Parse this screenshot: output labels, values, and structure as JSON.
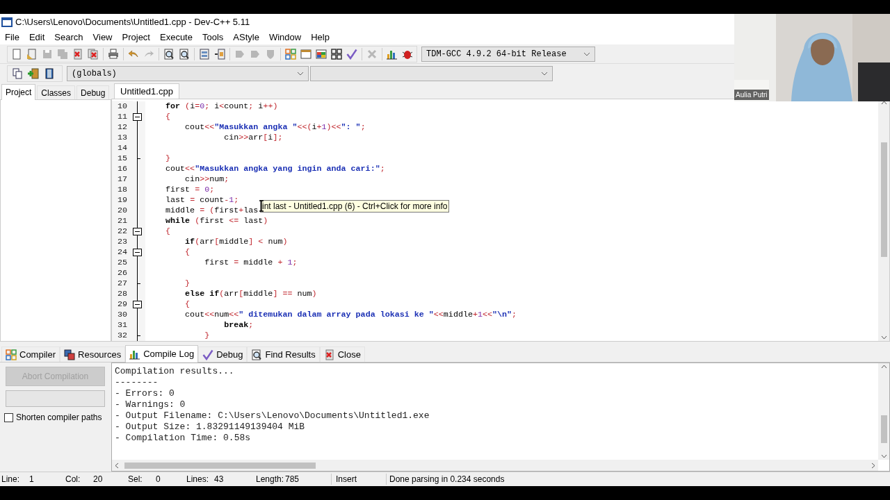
{
  "window": {
    "title": "C:\\Users\\Lenovo\\Documents\\Untitled1.cpp - Dev-C++ 5.11"
  },
  "menu": [
    "File",
    "Edit",
    "Search",
    "View",
    "Project",
    "Execute",
    "Tools",
    "AStyle",
    "Window",
    "Help"
  ],
  "toolbar": [
    {
      "disabled": false
    },
    {
      "disabled": false
    },
    {
      "disabled": true
    },
    {
      "disabled": true
    },
    {
      "disabled": false
    },
    {
      "disabled": false
    },
    {
      "disabled": false
    },
    {
      "disabled": false
    },
    {
      "disabled": true
    },
    {
      "disabled": false
    },
    {
      "disabled": false
    },
    {
      "disabled": false
    },
    {
      "disabled": false
    },
    {
      "disabled": true
    },
    {
      "disabled": true
    },
    {
      "disabled": true
    },
    {
      "disabled": false
    },
    {
      "disabled": false
    },
    {
      "disabled": false
    },
    {
      "disabled": false
    },
    {
      "disabled": false
    },
    {
      "disabled": true
    },
    {
      "disabled": false
    },
    {
      "disabled": false
    }
  ],
  "compiler_select": {
    "value": "TDM-GCC 4.9.2 64-bit Release"
  },
  "toolbar2": [
    {
      "disabled": false
    },
    {
      "disabled": false
    },
    {
      "disabled": false
    }
  ],
  "scope_select": {
    "value": "(globals)"
  },
  "left_tabs": [
    {
      "label": "Project",
      "selected": true
    },
    {
      "label": "Classes",
      "selected": false
    },
    {
      "label": "Debug",
      "selected": false
    }
  ],
  "editor_tabs": [
    {
      "label": "Untitled1.cpp",
      "selected": true
    }
  ],
  "code": [
    {
      "number": "10",
      "kind": "plain",
      "tokens": [
        {
          "kind": "kw",
          "t": "    for"
        },
        {
          "kind": "op",
          "t": " ("
        },
        {
          "kind": "id",
          "t": "i"
        },
        {
          "kind": "op",
          "t": "="
        },
        {
          "kind": "num",
          "t": "0"
        },
        {
          "kind": "op",
          "t": "; "
        },
        {
          "kind": "id",
          "t": "i"
        },
        {
          "kind": "op",
          "t": "<"
        },
        {
          "kind": "id",
          "t": "count"
        },
        {
          "kind": "op",
          "t": "; "
        },
        {
          "kind": "id",
          "t": "i"
        },
        {
          "kind": "op",
          "t": "++)"
        }
      ]
    },
    {
      "number": "11",
      "kind": "fold_start",
      "tokens": [
        {
          "kind": "op",
          "t": "    {"
        }
      ]
    },
    {
      "number": "12",
      "kind": "plain",
      "tokens": [
        {
          "kind": "id",
          "t": "        cout"
        },
        {
          "kind": "op",
          "t": "<<"
        },
        {
          "kind": "str",
          "t": "\"Masukkan angka \""
        },
        {
          "kind": "op",
          "t": "<<("
        },
        {
          "kind": "id",
          "t": "i"
        },
        {
          "kind": "op",
          "t": "+"
        },
        {
          "kind": "num",
          "t": "1"
        },
        {
          "kind": "op",
          "t": ")<<"
        },
        {
          "kind": "str",
          "t": "\": \""
        },
        {
          "kind": "op",
          "t": ";"
        }
      ]
    },
    {
      "number": "13",
      "kind": "plain",
      "tokens": [
        {
          "kind": "id",
          "t": "                cin"
        },
        {
          "kind": "op",
          "t": ">>"
        },
        {
          "kind": "id",
          "t": "arr"
        },
        {
          "kind": "op",
          "t": "["
        },
        {
          "kind": "id",
          "t": "i"
        },
        {
          "kind": "op",
          "t": "];"
        }
      ]
    },
    {
      "number": "14",
      "kind": "plain"
    },
    {
      "number": "15",
      "kind": "fold_end",
      "tokens": [
        {
          "kind": "op",
          "t": "    }"
        }
      ]
    },
    {
      "number": "16",
      "kind": "plain",
      "tokens": [
        {
          "kind": "id",
          "t": "    cout"
        },
        {
          "kind": "op",
          "t": "<<"
        },
        {
          "kind": "str",
          "t": "\"Masukkan angka yang ingin anda cari:\""
        },
        {
          "kind": "op",
          "t": ";"
        }
      ]
    },
    {
      "number": "17",
      "kind": "plain",
      "tokens": [
        {
          "kind": "id",
          "t": "        cin"
        },
        {
          "kind": "op",
          "t": ">>"
        },
        {
          "kind": "id",
          "t": "num"
        },
        {
          "kind": "op",
          "t": ";"
        }
      ]
    },
    {
      "number": "18",
      "kind": "plain",
      "tokens": [
        {
          "kind": "id",
          "t": "    first "
        },
        {
          "kind": "op",
          "t": "= "
        },
        {
          "kind": "num",
          "t": "0"
        },
        {
          "kind": "op",
          "t": ";"
        }
      ]
    },
    {
      "number": "19",
      "kind": "plain",
      "tokens": [
        {
          "kind": "id",
          "t": "    last "
        },
        {
          "kind": "op",
          "t": "= "
        },
        {
          "kind": "id",
          "t": "count"
        },
        {
          "kind": "op",
          "t": "-"
        },
        {
          "kind": "num",
          "t": "1"
        },
        {
          "kind": "op",
          "t": ";"
        }
      ]
    },
    {
      "number": "20",
      "kind": "plain",
      "tokens": [
        {
          "kind": "id",
          "t": "    middle "
        },
        {
          "kind": "op",
          "t": "= ("
        },
        {
          "kind": "id",
          "t": "first"
        },
        {
          "kind": "op",
          "t": "+"
        },
        {
          "kind": "id",
          "t": "las"
        }
      ]
    },
    {
      "number": "21",
      "kind": "plain",
      "tokens": [
        {
          "kind": "kw",
          "t": "    while"
        },
        {
          "kind": "op",
          "t": " ("
        },
        {
          "kind": "id",
          "t": "first "
        },
        {
          "kind": "op",
          "t": "<= "
        },
        {
          "kind": "id",
          "t": "last"
        },
        {
          "kind": "op",
          "t": ")"
        }
      ]
    },
    {
      "number": "22",
      "kind": "fold_start",
      "tokens": [
        {
          "kind": "op",
          "t": "    {"
        }
      ]
    },
    {
      "number": "23",
      "kind": "plain",
      "tokens": [
        {
          "kind": "kw",
          "t": "        if"
        },
        {
          "kind": "op",
          "t": "("
        },
        {
          "kind": "id",
          "t": "arr"
        },
        {
          "kind": "op",
          "t": "["
        },
        {
          "kind": "id",
          "t": "middle"
        },
        {
          "kind": "op",
          "t": "] < "
        },
        {
          "kind": "id",
          "t": "num"
        },
        {
          "kind": "op",
          "t": ")"
        }
      ]
    },
    {
      "number": "24",
      "kind": "fold_start",
      "tokens": [
        {
          "kind": "op",
          "t": "        {"
        }
      ]
    },
    {
      "number": "25",
      "kind": "plain",
      "tokens": [
        {
          "kind": "id",
          "t": "            first "
        },
        {
          "kind": "op",
          "t": "= "
        },
        {
          "kind": "id",
          "t": "middle "
        },
        {
          "kind": "op",
          "t": "+ "
        },
        {
          "kind": "num",
          "t": "1"
        },
        {
          "kind": "op",
          "t": ";"
        }
      ]
    },
    {
      "number": "26",
      "kind": "plain"
    },
    {
      "number": "27",
      "kind": "fold_end",
      "tokens": [
        {
          "kind": "op",
          "t": "        }"
        }
      ]
    },
    {
      "number": "28",
      "kind": "plain",
      "tokens": [
        {
          "kind": "kw",
          "t": "        else if"
        },
        {
          "kind": "op",
          "t": "("
        },
        {
          "kind": "id",
          "t": "arr"
        },
        {
          "kind": "op",
          "t": "["
        },
        {
          "kind": "id",
          "t": "middle"
        },
        {
          "kind": "op",
          "t": "] == "
        },
        {
          "kind": "id",
          "t": "num"
        },
        {
          "kind": "op",
          "t": ")"
        }
      ]
    },
    {
      "number": "29",
      "kind": "fold_start",
      "tokens": [
        {
          "kind": "op",
          "t": "        {"
        }
      ]
    },
    {
      "number": "30",
      "kind": "plain",
      "tokens": [
        {
          "kind": "id",
          "t": "        cout"
        },
        {
          "kind": "op",
          "t": "<<"
        },
        {
          "kind": "id",
          "t": "num"
        },
        {
          "kind": "op",
          "t": "<<"
        },
        {
          "kind": "str",
          "t": "\" ditemukan dalam array pada lokasi ke \""
        },
        {
          "kind": "op",
          "t": "<<"
        },
        {
          "kind": "id",
          "t": "middle"
        },
        {
          "kind": "op",
          "t": "+"
        },
        {
          "kind": "num",
          "t": "1"
        },
        {
          "kind": "op",
          "t": "<<"
        },
        {
          "kind": "str",
          "t": "\"\\n\""
        },
        {
          "kind": "op",
          "t": ";"
        }
      ]
    },
    {
      "number": "31",
      "kind": "plain",
      "tokens": [
        {
          "kind": "kw",
          "t": "                break"
        },
        {
          "kind": "op",
          "t": ";"
        }
      ]
    },
    {
      "number": "32",
      "kind": "fold_end",
      "tokens": [
        {
          "kind": "op",
          "t": "            }"
        }
      ]
    }
  ],
  "tooltip": "int last - Untitled1.cpp (6) - Ctrl+Click for more info",
  "bottom_tabs": [
    {
      "label": "Compiler",
      "selected": false
    },
    {
      "label": "Resources",
      "selected": false
    },
    {
      "label": "Compile Log",
      "selected": true
    },
    {
      "label": "Debug",
      "selected": false
    },
    {
      "label": "Find Results",
      "selected": false
    },
    {
      "label": "Close",
      "selected": false
    }
  ],
  "compile_panel": {
    "abort_button": {
      "label": "Abort Compilation",
      "disabled": true
    },
    "progress": {
      "level": 0
    },
    "shorten_paths": {
      "label": "Shorten compiler paths",
      "checked": false
    }
  },
  "compile_log": [
    "Compilation results...",
    "--------",
    "- Errors: 0",
    "- Warnings: 0",
    "- Output Filename: C:\\Users\\Lenovo\\Documents\\Untitled1.exe",
    "- Output Size: 1.83291149139404 MiB",
    "- Compilation Time: 0.58s"
  ],
  "status_bar": {
    "fields": [
      {
        "label": "Line:",
        "value": "1"
      },
      {
        "label": "Col:",
        "value": "20"
      },
      {
        "label": "Sel:",
        "value": "0"
      },
      {
        "label": "Lines:",
        "value": "43"
      },
      {
        "label": "Length:",
        "value": "785"
      }
    ],
    "mode": "Insert",
    "message": "Done parsing in 0.234 seconds"
  },
  "webcam": {
    "name": "Aulia Putri"
  }
}
